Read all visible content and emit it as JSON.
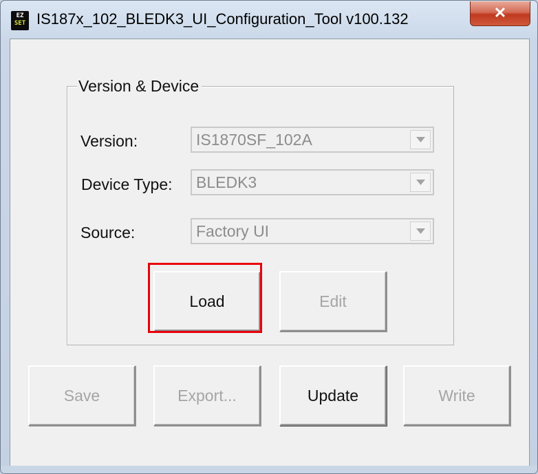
{
  "window": {
    "title": "IS187x_102_BLEDK3_UI_Configuration_Tool v100.132",
    "icon": {
      "name": "ez-set-app-icon",
      "top_text": "EZ",
      "bottom_text": "SET"
    },
    "close_glyph": "✕"
  },
  "group": {
    "legend": "Version & Device",
    "fields": [
      {
        "label": "Version:",
        "value": "IS1870SF_102A"
      },
      {
        "label": "Device Type:",
        "value": "BLEDK3"
      },
      {
        "label": "Source:",
        "value": "Factory UI"
      }
    ],
    "load_label": "Load",
    "edit_label": "Edit"
  },
  "actions": {
    "save_label": "Save",
    "export_label": "Export...",
    "update_label": "Update",
    "write_label": "Write"
  },
  "colors": {
    "highlight": "#e8000b",
    "disabled_text": "#a5a5a5"
  }
}
